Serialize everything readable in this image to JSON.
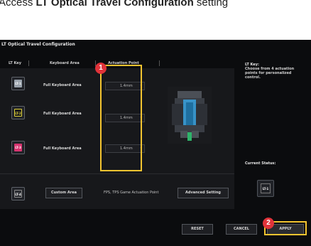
{
  "caption": {
    "prefix": "Access ",
    "bold": "LT Optical Travel Configuration",
    "suffix": " setting"
  },
  "window": {
    "title": "LT Optical Travel Configuration"
  },
  "columns": {
    "lt_key": "LT Key",
    "keyboard_area": "Keyboard Area",
    "actuation_point": "Actuation Point"
  },
  "rows": [
    {
      "key": "LT-1",
      "key_color": "#9aa3ad",
      "area": "Full Keyboard Area",
      "actuation": "1.4mm"
    },
    {
      "key": "LT-2",
      "key_color": "#e0d23a",
      "area": "Full Keyboard Area",
      "actuation": "1.4mm"
    },
    {
      "key": "LT-3",
      "key_color": "#d7336f",
      "area": "Full Keyboard Area",
      "actuation": "1.4mm"
    }
  ],
  "custom_row": {
    "key": "LT-4",
    "area": "Custom Area",
    "label": "FPS, TPS Game Actuation Point",
    "advanced_button": "Advanced Setting"
  },
  "sidebar": {
    "title": "LT Key:",
    "description": "Choose from 4 actuation points for personalized control.",
    "status_label": "Current Status:",
    "status_key": "LT-1"
  },
  "buttons": {
    "reset": "RESET",
    "cancel": "CANCEL",
    "apply": "APPLY"
  },
  "badges": {
    "one": "1",
    "two": "2"
  },
  "colors": {
    "highlight": "#f4c430",
    "badge": "#e0333a"
  }
}
